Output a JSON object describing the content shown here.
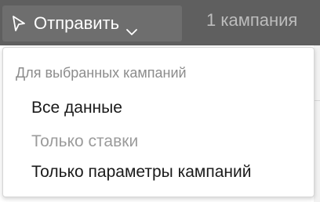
{
  "toolbar": {
    "send_label": "Отправить",
    "send_icon": "send-arrow-icon",
    "dropdown_icon": "chevron-down-icon",
    "selection_count": "1 кампания"
  },
  "dropdown": {
    "header": "Для выбранных кампаний",
    "items": [
      {
        "label": "Все данные",
        "enabled": true
      },
      {
        "label": "Только ставки",
        "enabled": false
      },
      {
        "label": "Только параметры кампаний",
        "enabled": true
      }
    ]
  },
  "colors": {
    "toolbar_bg": "#5f5f5f",
    "button_bg": "#6e6e6e",
    "text_primary": "#1a1a1a",
    "text_disabled": "#9b9b9b",
    "header_text": "#8c8c8c"
  }
}
